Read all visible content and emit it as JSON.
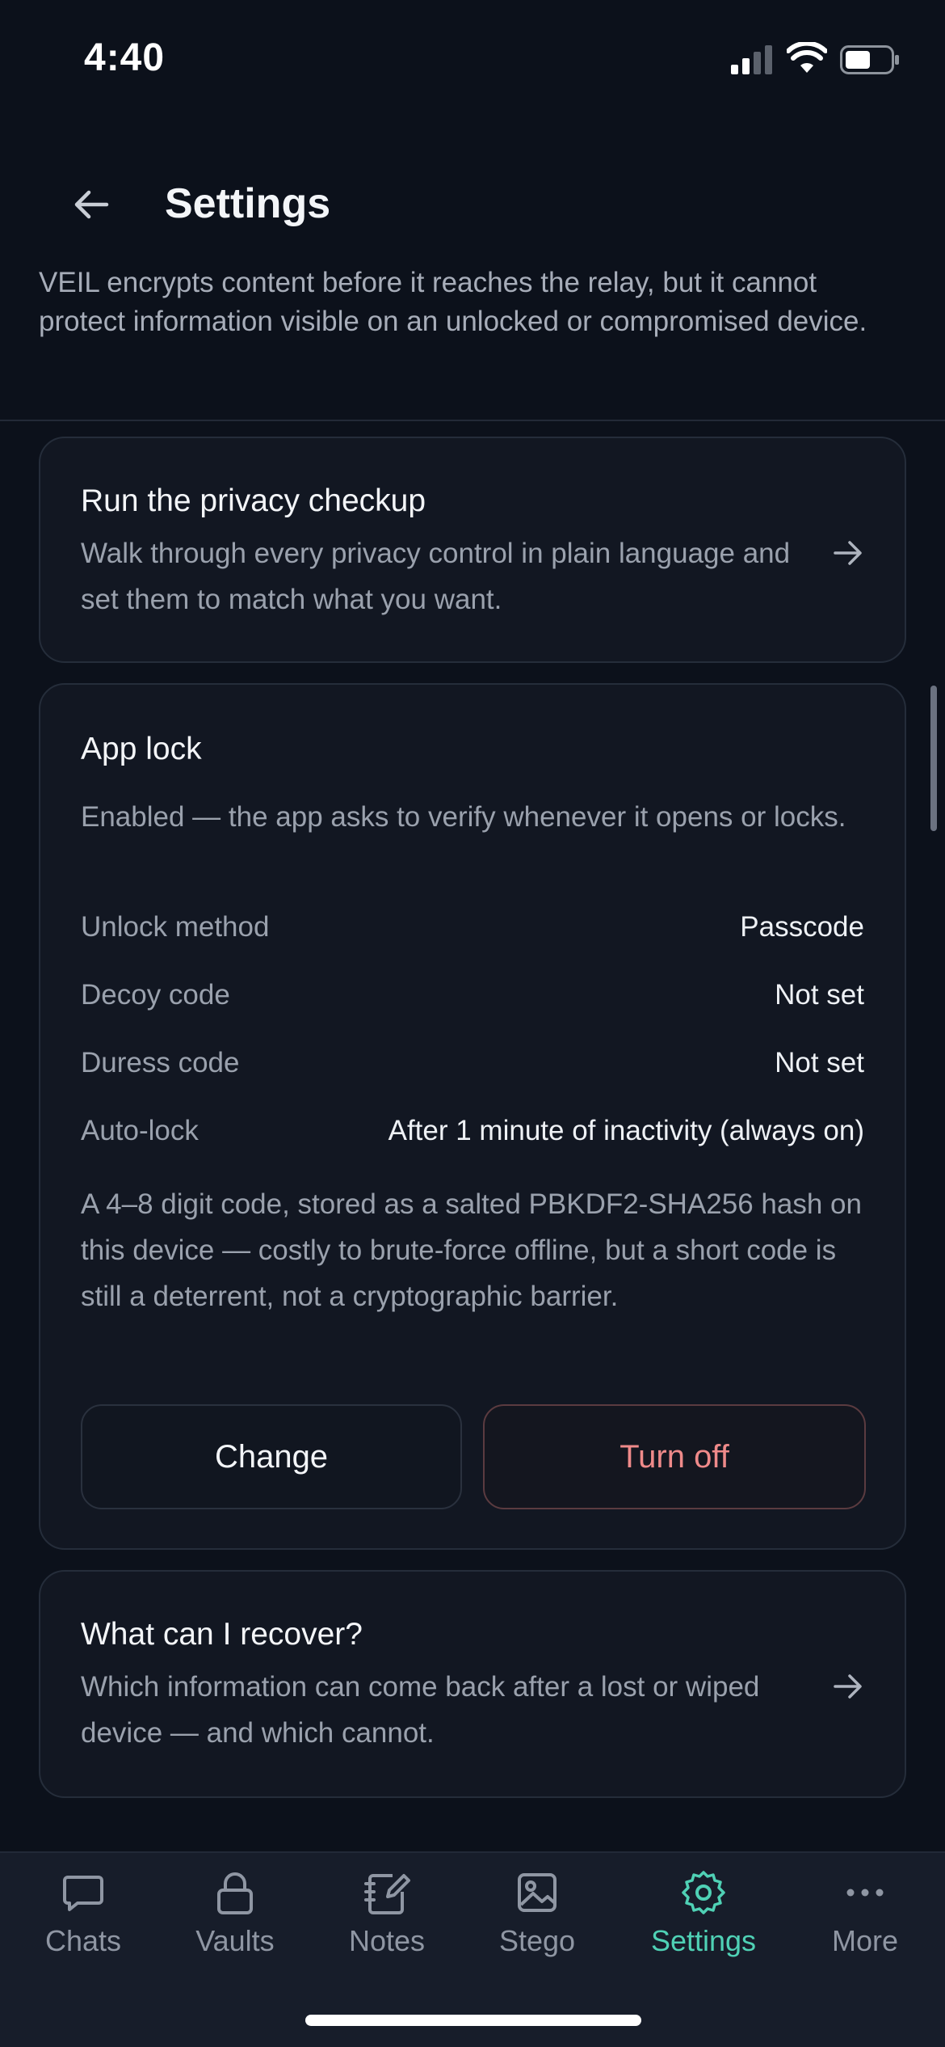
{
  "status_bar": {
    "time": "4:40"
  },
  "header": {
    "title": "Settings",
    "intro": "VEIL encrypts content before it reaches the relay, but it cannot protect information visible on an unlocked or compromised device."
  },
  "privacy_checkup": {
    "title": "Run the privacy checkup",
    "subtitle": "Walk through every privacy control in plain language and set them to match what you want."
  },
  "app_lock": {
    "title": "App lock",
    "status": "Enabled — the app asks to verify whenever it opens or locks.",
    "rows": [
      {
        "label": "Unlock method",
        "value": "Passcode"
      },
      {
        "label": "Decoy code",
        "value": "Not set"
      },
      {
        "label": "Duress code",
        "value": "Not set"
      },
      {
        "label": "Auto-lock",
        "value": "After 1 minute of inactivity (always on)"
      }
    ],
    "note": "A 4–8 digit code, stored as a salted PBKDF2-SHA256 hash on this device — costly to brute-force offline, but a short code is still a deterrent, not a cryptographic barrier.",
    "change_label": "Change",
    "turn_off_label": "Turn off"
  },
  "recover": {
    "title": "What can I recover?",
    "subtitle": "Which information can come back after a lost or wiped device — and which cannot."
  },
  "tabs": [
    {
      "label": "Chats",
      "icon": "chat-bubble-icon"
    },
    {
      "label": "Vaults",
      "icon": "lock-icon"
    },
    {
      "label": "Notes",
      "icon": "notes-icon"
    },
    {
      "label": "Stego",
      "icon": "image-icon"
    },
    {
      "label": "Settings",
      "icon": "gear-icon",
      "active": true
    },
    {
      "label": "More",
      "icon": "more-dots-icon"
    }
  ],
  "colors": {
    "background": "#0c111b",
    "accent": "#4fd1b5",
    "danger": "#ef8a8a"
  }
}
